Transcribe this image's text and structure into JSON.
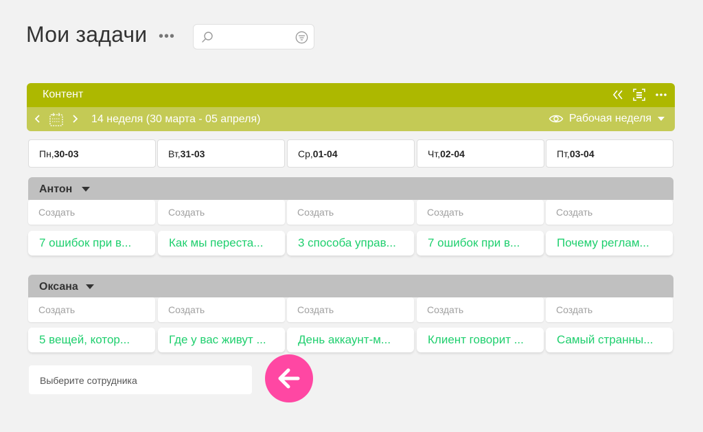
{
  "page": {
    "title": "Мои задачи"
  },
  "search": {
    "placeholder": ""
  },
  "board": {
    "name": "Контент",
    "week_label": "14 неделя (30 марта - 05 апреля)",
    "view_mode": "Рабочая неделя"
  },
  "days": [
    {
      "weekday": "Пн,",
      "date": "30-03"
    },
    {
      "weekday": "Вт,",
      "date": "31-03"
    },
    {
      "weekday": "Ср,",
      "date": "01-04"
    },
    {
      "weekday": "Чт,",
      "date": "02-04"
    },
    {
      "weekday": "Пт,",
      "date": "03-04"
    }
  ],
  "groups": [
    {
      "name": "Антон",
      "create_label": "Создать",
      "tasks": [
        "7 ошибок при в...",
        "Как мы переста...",
        "3 способа управ...",
        "7 ошибок при в...",
        "Почему реглам..."
      ]
    },
    {
      "name": "Оксана",
      "create_label": "Создать",
      "tasks": [
        "5 вещей, котор...",
        "Где у вас живут ...",
        "День аккаунт-м...",
        "Клиент говорит ...",
        "Самый странны..."
      ]
    }
  ],
  "employee_select": {
    "placeholder": "Выберите сотрудника"
  },
  "colors": {
    "board_header": "#adb800",
    "board_subheader": "#c4ca55",
    "task_text": "#1fcf6e",
    "arrow_button": "#ff47a3",
    "group_bar": "#c0c0c0"
  },
  "icons": {
    "title_menu": "more-dots-icon",
    "search": "search-icon",
    "filter": "filter-icon",
    "collapse": "double-chevron-left-icon",
    "board_settings": "board-settings-icon",
    "board_menu": "more-dots-icon",
    "prev": "chevron-left-icon",
    "calendar": "calendar-icon",
    "next": "chevron-right-icon",
    "view": "eye-icon",
    "dropdown": "caret-down-icon",
    "arrow": "arrow-left-icon"
  }
}
